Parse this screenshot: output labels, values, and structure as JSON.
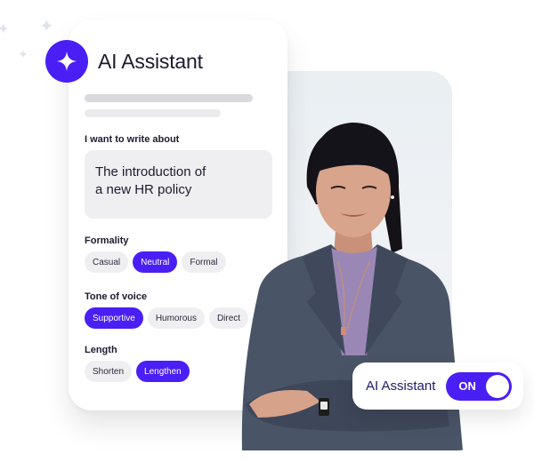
{
  "colors": {
    "accent": "#4a1ff5",
    "chip_bg": "#efeff2",
    "text": "#1c1b2e",
    "toggle_label": "#1e1a6e"
  },
  "header": {
    "icon": "sparkle-icon",
    "title": "AI Assistant"
  },
  "form": {
    "topic": {
      "label": "I want to write about",
      "lines": [
        "The introduction of",
        "a new HR policy"
      ]
    },
    "formality": {
      "label": "Formality",
      "options": [
        {
          "label": "Casual",
          "selected": false
        },
        {
          "label": "Neutral",
          "selected": true
        },
        {
          "label": "Formal",
          "selected": false
        }
      ]
    },
    "tone": {
      "label": "Tone of voice",
      "options": [
        {
          "label": "Supportive",
          "selected": true
        },
        {
          "label": "Humorous",
          "selected": false
        },
        {
          "label": "Direct",
          "selected": false
        }
      ]
    },
    "length": {
      "label": "Length",
      "options": [
        {
          "label": "Shorten",
          "selected": false
        },
        {
          "label": "Lengthen",
          "selected": true
        }
      ]
    }
  },
  "toggle": {
    "label": "AI Assistant",
    "state": "ON"
  },
  "photo": {
    "description": "Smiling woman with dark hair and bangs, wearing a grey blazer over a lavender turtleneck, arms crossed"
  }
}
